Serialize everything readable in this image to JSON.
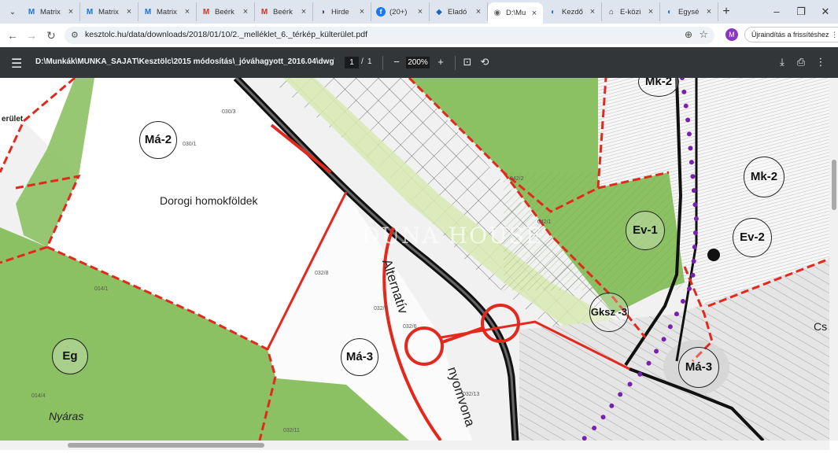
{
  "browser": {
    "tabs": [
      {
        "title": "Matrix",
        "fav": "M",
        "color": "#1a73e8"
      },
      {
        "title": "Matrix",
        "fav": "M",
        "color": "#1a73e8"
      },
      {
        "title": "Matrix",
        "fav": "M",
        "color": "#1a73e8"
      },
      {
        "title": "Beérk",
        "fav": "M",
        "color": "#d93025"
      },
      {
        "title": "Beérk",
        "fav": "M",
        "color": "#d93025"
      },
      {
        "title": "Hirde",
        "fav": "◑",
        "color": "#5a3a7a"
      },
      {
        "title": "(20+)",
        "fav": "f",
        "color": "#1877f2"
      },
      {
        "title": "Eladó",
        "fav": "◆",
        "color": "#1565c0"
      },
      {
        "title": "D:\\Mu",
        "fav": "◉",
        "color": "#5f6368"
      },
      {
        "title": "Kezdő",
        "fav": "◐",
        "color": "#1976d2"
      },
      {
        "title": "E-közi",
        "fav": "⌂",
        "color": "#333333"
      },
      {
        "title": "Egysé",
        "fav": "◐",
        "color": "#1976d2"
      }
    ],
    "active_tab_index": 8,
    "new_tab_symbol": "+",
    "url": "kesztolc.hu/data/downloads/2018/01/10/2._melléklet_6._térkép_külterület.pdf",
    "restart_label": "Újraindítás a frissítéshez",
    "avatar_letter": "M"
  },
  "pdf": {
    "title": "D:\\Munkák\\MUNKA_SAJÁT\\Kesztölc\\2015 módosítás\\_jóváhagyott_2016.04\\dwg\\Kes...",
    "page_current": "1",
    "page_sep": "/",
    "page_total": "1",
    "zoom": "200%"
  },
  "map": {
    "zones": [
      {
        "label": "Má-2"
      },
      {
        "label": "Má-3"
      },
      {
        "label": "Eg"
      },
      {
        "label": "Ev-1"
      },
      {
        "label": "Ev-2"
      },
      {
        "label": "Mk-2"
      },
      {
        "label": "Mk-2"
      },
      {
        "label": "Gksz -3"
      },
      {
        "label": "Má-3"
      }
    ],
    "texts": {
      "dorogi": "Dorogi homokföldek",
      "alternativ": "Alternatív",
      "nyomvonal": "nyomvona",
      "nyaras": "Nyáras",
      "terulet": "erület",
      "cs": "Cs",
      "watermark": "DUNA HOUSE"
    },
    "parcels": [
      "030/3",
      "030/1",
      "032/8",
      "032/7",
      "032/6",
      "032/13",
      "042/2",
      "042/1",
      "014/1",
      "014/4",
      "032/11"
    ],
    "colors": {
      "forest": "#8cc163",
      "light_green": "#d8e9b3",
      "boundary": "#e3281d",
      "road": "#111111",
      "purple": "#7a1fb0"
    }
  }
}
